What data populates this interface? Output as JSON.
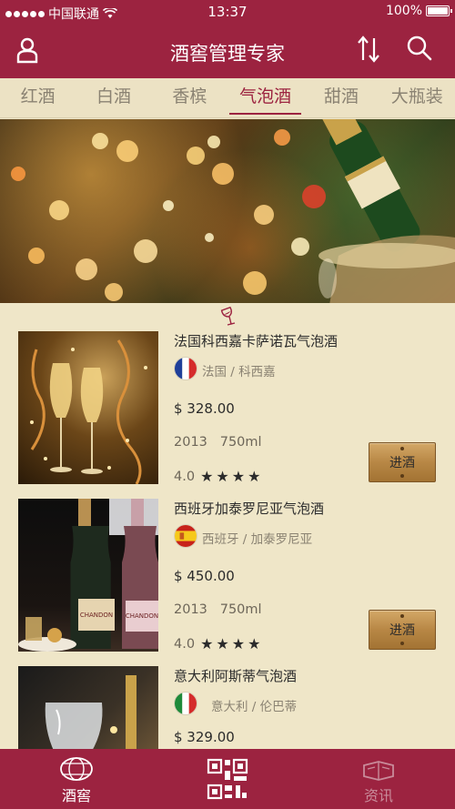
{
  "status_bar": {
    "carrier": "中国联通",
    "time": "13:37",
    "battery": "100%"
  },
  "nav": {
    "title": "酒窖管理专家",
    "user_icon": "user-icon",
    "sort_icon": "sort-icon",
    "search_icon": "search-icon"
  },
  "tabs": [
    {
      "label": "红酒",
      "active": false
    },
    {
      "label": "白酒",
      "active": false
    },
    {
      "label": "香槟",
      "active": false
    },
    {
      "label": "气泡酒",
      "active": true
    },
    {
      "label": "甜酒",
      "active": false
    },
    {
      "label": "大瓶装",
      "active": false
    }
  ],
  "products": [
    {
      "name": "法国科西嘉卡萨诺瓦气泡酒",
      "origin": "法国 / 科西嘉",
      "price": "$ 328.00",
      "vintage": "2013",
      "volume": "750ml",
      "rating": "4.0",
      "stars": 4,
      "button": "进酒",
      "flag": "france"
    },
    {
      "name": "西班牙加泰罗尼亚气泡酒",
      "origin": "西班牙 / 加泰罗尼亚",
      "price": "$ 450.00",
      "vintage": "2013",
      "volume": "750ml",
      "rating": "4.0",
      "stars": 4,
      "button": "进酒",
      "flag": "spain"
    },
    {
      "name": "意大利阿斯蒂气泡酒",
      "origin": "意大利 / 伦巴蒂",
      "price": "$ 329.00",
      "flag": "italy"
    }
  ],
  "tabbar": {
    "cellar": "酒窖",
    "news": "资讯",
    "scan_icon": "qr-code-icon"
  },
  "colors": {
    "brand": "#9c2340",
    "background": "#efe6c8"
  }
}
